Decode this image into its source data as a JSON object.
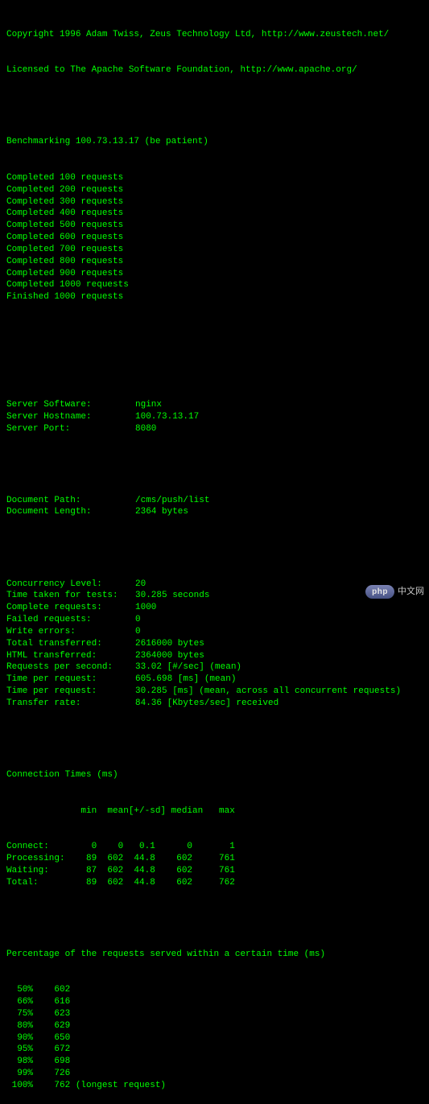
{
  "header": {
    "copyright": "Copyright 1996 Adam Twiss, Zeus Technology Ltd, http://www.zeustech.net/",
    "license": "Licensed to The Apache Software Foundation, http://www.apache.org/"
  },
  "benchmark": {
    "line": "Benchmarking 100.73.13.17 (be patient)",
    "progress": [
      "Completed 100 requests",
      "Completed 200 requests",
      "Completed 300 requests",
      "Completed 400 requests",
      "Completed 500 requests",
      "Completed 600 requests",
      "Completed 700 requests",
      "Completed 800 requests",
      "Completed 900 requests",
      "Completed 1000 requests",
      "Finished 1000 requests"
    ]
  },
  "server": [
    {
      "label": "Server Software:",
      "value": "nginx"
    },
    {
      "label": "Server Hostname:",
      "value": "100.73.13.17"
    },
    {
      "label": "Server Port:",
      "value": "8080"
    }
  ],
  "document": [
    {
      "label": "Document Path:",
      "value": "/cms/push/list"
    },
    {
      "label": "Document Length:",
      "value": "2364 bytes"
    }
  ],
  "results": [
    {
      "label": "Concurrency Level:",
      "value": "20"
    },
    {
      "label": "Time taken for tests:",
      "value": "30.285 seconds"
    },
    {
      "label": "Complete requests:",
      "value": "1000"
    },
    {
      "label": "Failed requests:",
      "value": "0"
    },
    {
      "label": "Write errors:",
      "value": "0"
    },
    {
      "label": "Total transferred:",
      "value": "2616000 bytes"
    },
    {
      "label": "HTML transferred:",
      "value": "2364000 bytes"
    },
    {
      "label": "Requests per second:",
      "value": "33.02 [#/sec] (mean)"
    },
    {
      "label": "Time per request:",
      "value": "605.698 [ms] (mean)"
    },
    {
      "label": "Time per request:",
      "value": "30.285 [ms] (mean, across all concurrent requests)"
    },
    {
      "label": "Transfer rate:",
      "value": "84.36 [Kbytes/sec] received"
    }
  ],
  "conn_times": {
    "title": "Connection Times (ms)",
    "header": "              min  mean[+/-sd] median   max",
    "rows": [
      {
        "name": "Connect:",
        "min": 0,
        "mean": 0,
        "sd": "0.1",
        "median": 0,
        "max": 1
      },
      {
        "name": "Processing:",
        "min": 89,
        "mean": 602,
        "sd": "44.8",
        "median": 602,
        "max": 761
      },
      {
        "name": "Waiting:",
        "min": 87,
        "mean": 602,
        "sd": "44.8",
        "median": 602,
        "max": 761
      },
      {
        "name": "Total:",
        "min": 89,
        "mean": 602,
        "sd": "44.8",
        "median": 602,
        "max": 762
      }
    ]
  },
  "percentiles": {
    "title": "Percentage of the requests served within a certain time (ms)",
    "rows": [
      {
        "pct": "50%",
        "val": 602,
        "note": ""
      },
      {
        "pct": "66%",
        "val": 616,
        "note": ""
      },
      {
        "pct": "75%",
        "val": 623,
        "note": ""
      },
      {
        "pct": "80%",
        "val": 629,
        "note": ""
      },
      {
        "pct": "90%",
        "val": 650,
        "note": ""
      },
      {
        "pct": "95%",
        "val": 672,
        "note": ""
      },
      {
        "pct": "98%",
        "val": 698,
        "note": ""
      },
      {
        "pct": "99%",
        "val": 726,
        "note": ""
      },
      {
        "pct": "100%",
        "val": 762,
        "note": " (longest request)"
      }
    ]
  },
  "watermark": {
    "badge": "php",
    "text": "中文网"
  }
}
